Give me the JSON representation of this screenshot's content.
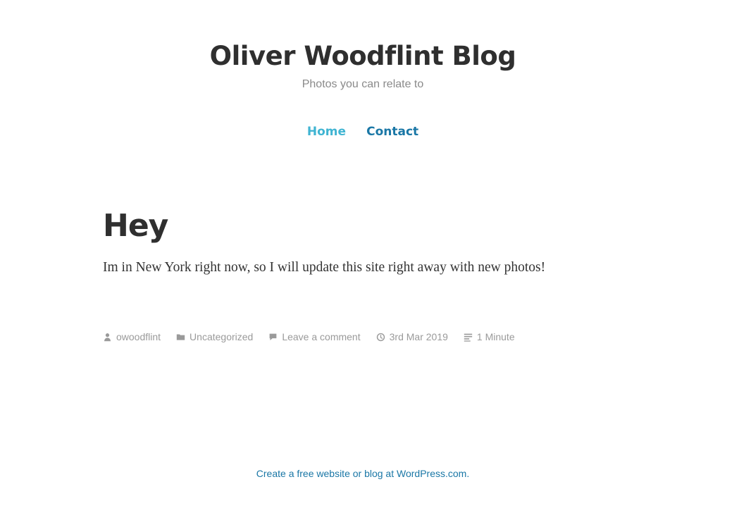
{
  "site": {
    "title": "Oliver Woodflint Blog",
    "tagline": "Photos you can relate to"
  },
  "nav": {
    "items": [
      {
        "label": "Home"
      },
      {
        "label": "Contact"
      }
    ]
  },
  "post": {
    "title": "Hey",
    "content": "Im in New York right now, so I will update this site right away with new photos!",
    "meta": {
      "author": "owoodflint",
      "category": "Uncategorized",
      "comments": "Leave a comment",
      "date": "3rd Mar 2019",
      "reading_time": "1 Minute"
    }
  },
  "footer": {
    "credit": "Create a free website or blog at WordPress.com."
  },
  "colors": {
    "nav_current": "#3fb4d2",
    "link": "#1a77a6",
    "meta": "#9a9a9a",
    "title": "#2f2f2f"
  }
}
